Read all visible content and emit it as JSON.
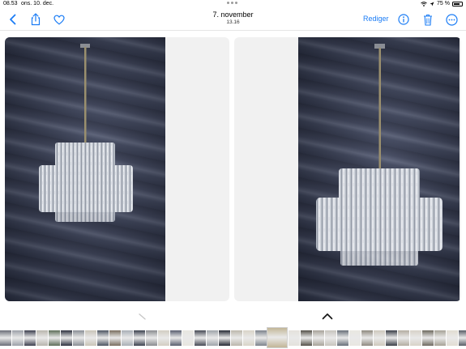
{
  "status_bar": {
    "time": "08.53",
    "date": "ons. 10. dec.",
    "battery_percent": "75 %",
    "battery_level": 0.75
  },
  "nav": {
    "back_icon": "chevron-left-icon",
    "title": "7. november",
    "subtitle": "13.16",
    "edit_label": "Rediger",
    "icons": [
      "share-icon",
      "heart-icon",
      "info-icon",
      "trash-icon",
      "more-icon"
    ],
    "accent_color": "#1a7cf5"
  },
  "photos": [
    {
      "name": "chandelier-photo-1"
    },
    {
      "name": "chandelier-photo-2"
    }
  ],
  "thumbnail_colors": [
    "#6b6e78",
    "#9ca0a8",
    "#3e4150",
    "#b8b5ad",
    "#5f6f5a",
    "#2f3340",
    "#8b8f96",
    "#c9c4b8",
    "#4d5563",
    "#7a6e5f",
    "#a9afb6",
    "#3d4350",
    "#8a8c90",
    "#d2cdc2",
    "#5a6070",
    "#e8e6e0",
    "#474b56",
    "#9fa4aa",
    "#262a34",
    "#bcb7ac",
    "#d9d4c8",
    "#7d838c",
    "#c2b697",
    "#e4e2dc",
    "#55524a",
    "#a8a39a",
    "#c7c4bd",
    "#69707a",
    "#e9e7e1",
    "#8f8a80",
    "#cfc9bd",
    "#3b3f48",
    "#b3ada1",
    "#d7d2c8",
    "#6f6a60",
    "#a6a296",
    "#e2ddd2",
    "#5a5e67"
  ]
}
